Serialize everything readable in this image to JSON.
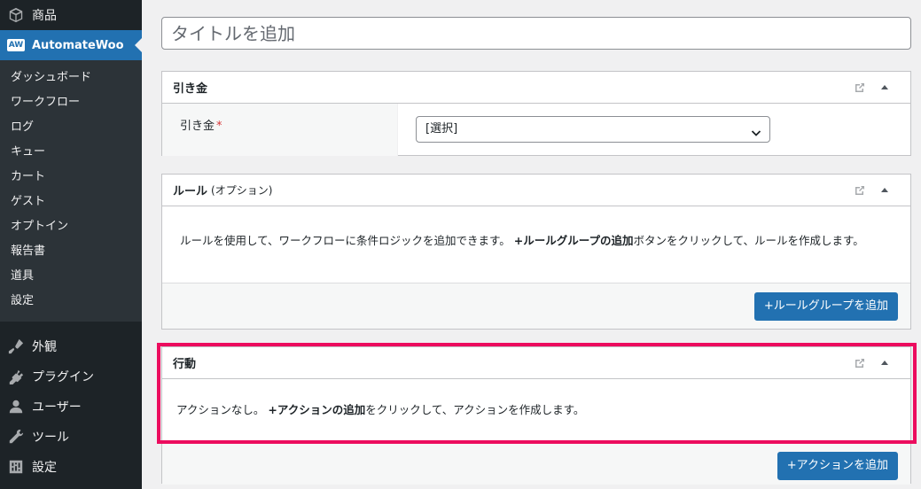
{
  "sidebar": {
    "products_label": "商品",
    "automatewoo_label": "AutomateWoo",
    "automatewoo_badge": "AW",
    "submenu": [
      {
        "label": "ダッシュボード"
      },
      {
        "label": "ワークフロー"
      },
      {
        "label": "ログ"
      },
      {
        "label": "キュー"
      },
      {
        "label": "カート"
      },
      {
        "label": "ゲスト"
      },
      {
        "label": "オプトイン"
      },
      {
        "label": "報告書"
      },
      {
        "label": "道具"
      },
      {
        "label": "設定"
      }
    ],
    "main_items": [
      {
        "label": "外観",
        "icon": "brush-icon"
      },
      {
        "label": "プラグイン",
        "icon": "plugin-icon"
      },
      {
        "label": "ユーザー",
        "icon": "user-icon"
      },
      {
        "label": "ツール",
        "icon": "wrench-icon"
      },
      {
        "label": "設定",
        "icon": "settings-icon"
      }
    ]
  },
  "title": {
    "placeholder": "タイトルを追加"
  },
  "trigger": {
    "heading": "引き金",
    "field_label": "引き金",
    "required_mark": "*",
    "select_value": "[選択]"
  },
  "rules": {
    "heading": "ルール",
    "subheading": "(オプション)",
    "text_before": "ルールを使用して、ワークフローに条件ロジックを追加できます。",
    "text_bold": "+ルールグループの追加",
    "text_after": "ボタンをクリックして、ルールを作成します。",
    "button_label": "+ルールグループを追加"
  },
  "actions": {
    "heading": "行動",
    "text_before": "アクションなし。",
    "text_bold": "+アクションの追加",
    "text_after": "をクリックして、アクションを作成します。",
    "button_label": "+アクションを追加"
  },
  "colors": {
    "sidebar_bg": "#1d2327",
    "submenu_bg": "#2c3338",
    "accent": "#2271b1",
    "highlight": "#ec0c5e",
    "required": "#d63638"
  }
}
